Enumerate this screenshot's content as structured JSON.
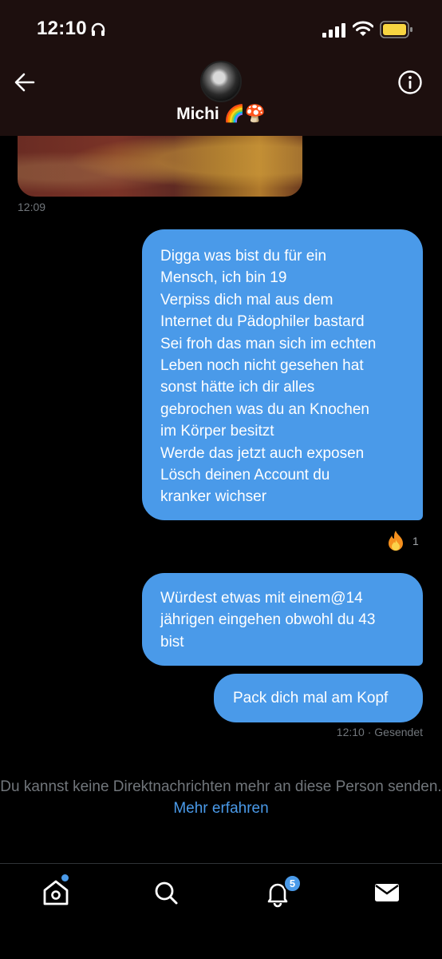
{
  "status_bar": {
    "time": "12:10",
    "icons": [
      "headphones-icon",
      "cellular-signal-icon",
      "wifi-icon",
      "battery-icon"
    ]
  },
  "header": {
    "contact_name": "Michi 🌈🍄",
    "icons": [
      "back-arrow-icon",
      "info-icon"
    ]
  },
  "messages": {
    "photo_timestamp": "12:09",
    "bubble1_lines": [
      "Digga was bist du für ein",
      "Mensch, ich bin 19",
      "Verpiss dich mal aus dem",
      "Internet du Pädophiler bastard",
      "Sei froh das man sich im echten",
      "Leben noch nicht gesehen hat",
      "sonst hätte ich dir alles",
      "gebrochen was du an Knochen",
      "im Körper besitzt",
      "Werde das jetzt auch exposen",
      "Lösch deinen Account du",
      "kranker wichser"
    ],
    "reaction_emoji": "🔥",
    "reaction_count": "1",
    "bubble2_lines": [
      "Würdest etwas mit einem@14",
      "jährigen eingehen obwohl du 43",
      "bist"
    ],
    "bubble3": "Pack dich mal am Kopf",
    "sent_time": "12:10",
    "sent_status": " · Gesendet"
  },
  "notice": {
    "text": "Du kannst keine Direktnachrichten mehr an diese Person senden.",
    "link": "Mehr erfahren"
  },
  "tab_bar": {
    "notification_count": "5",
    "icons": [
      "home-icon",
      "search-icon",
      "notifications-bell-icon",
      "messages-envelope-icon"
    ]
  },
  "colors": {
    "accent": "#4a9ae9",
    "background": "#000000",
    "muted_text": "#71767b",
    "header_bg": "#1d0f0e"
  }
}
